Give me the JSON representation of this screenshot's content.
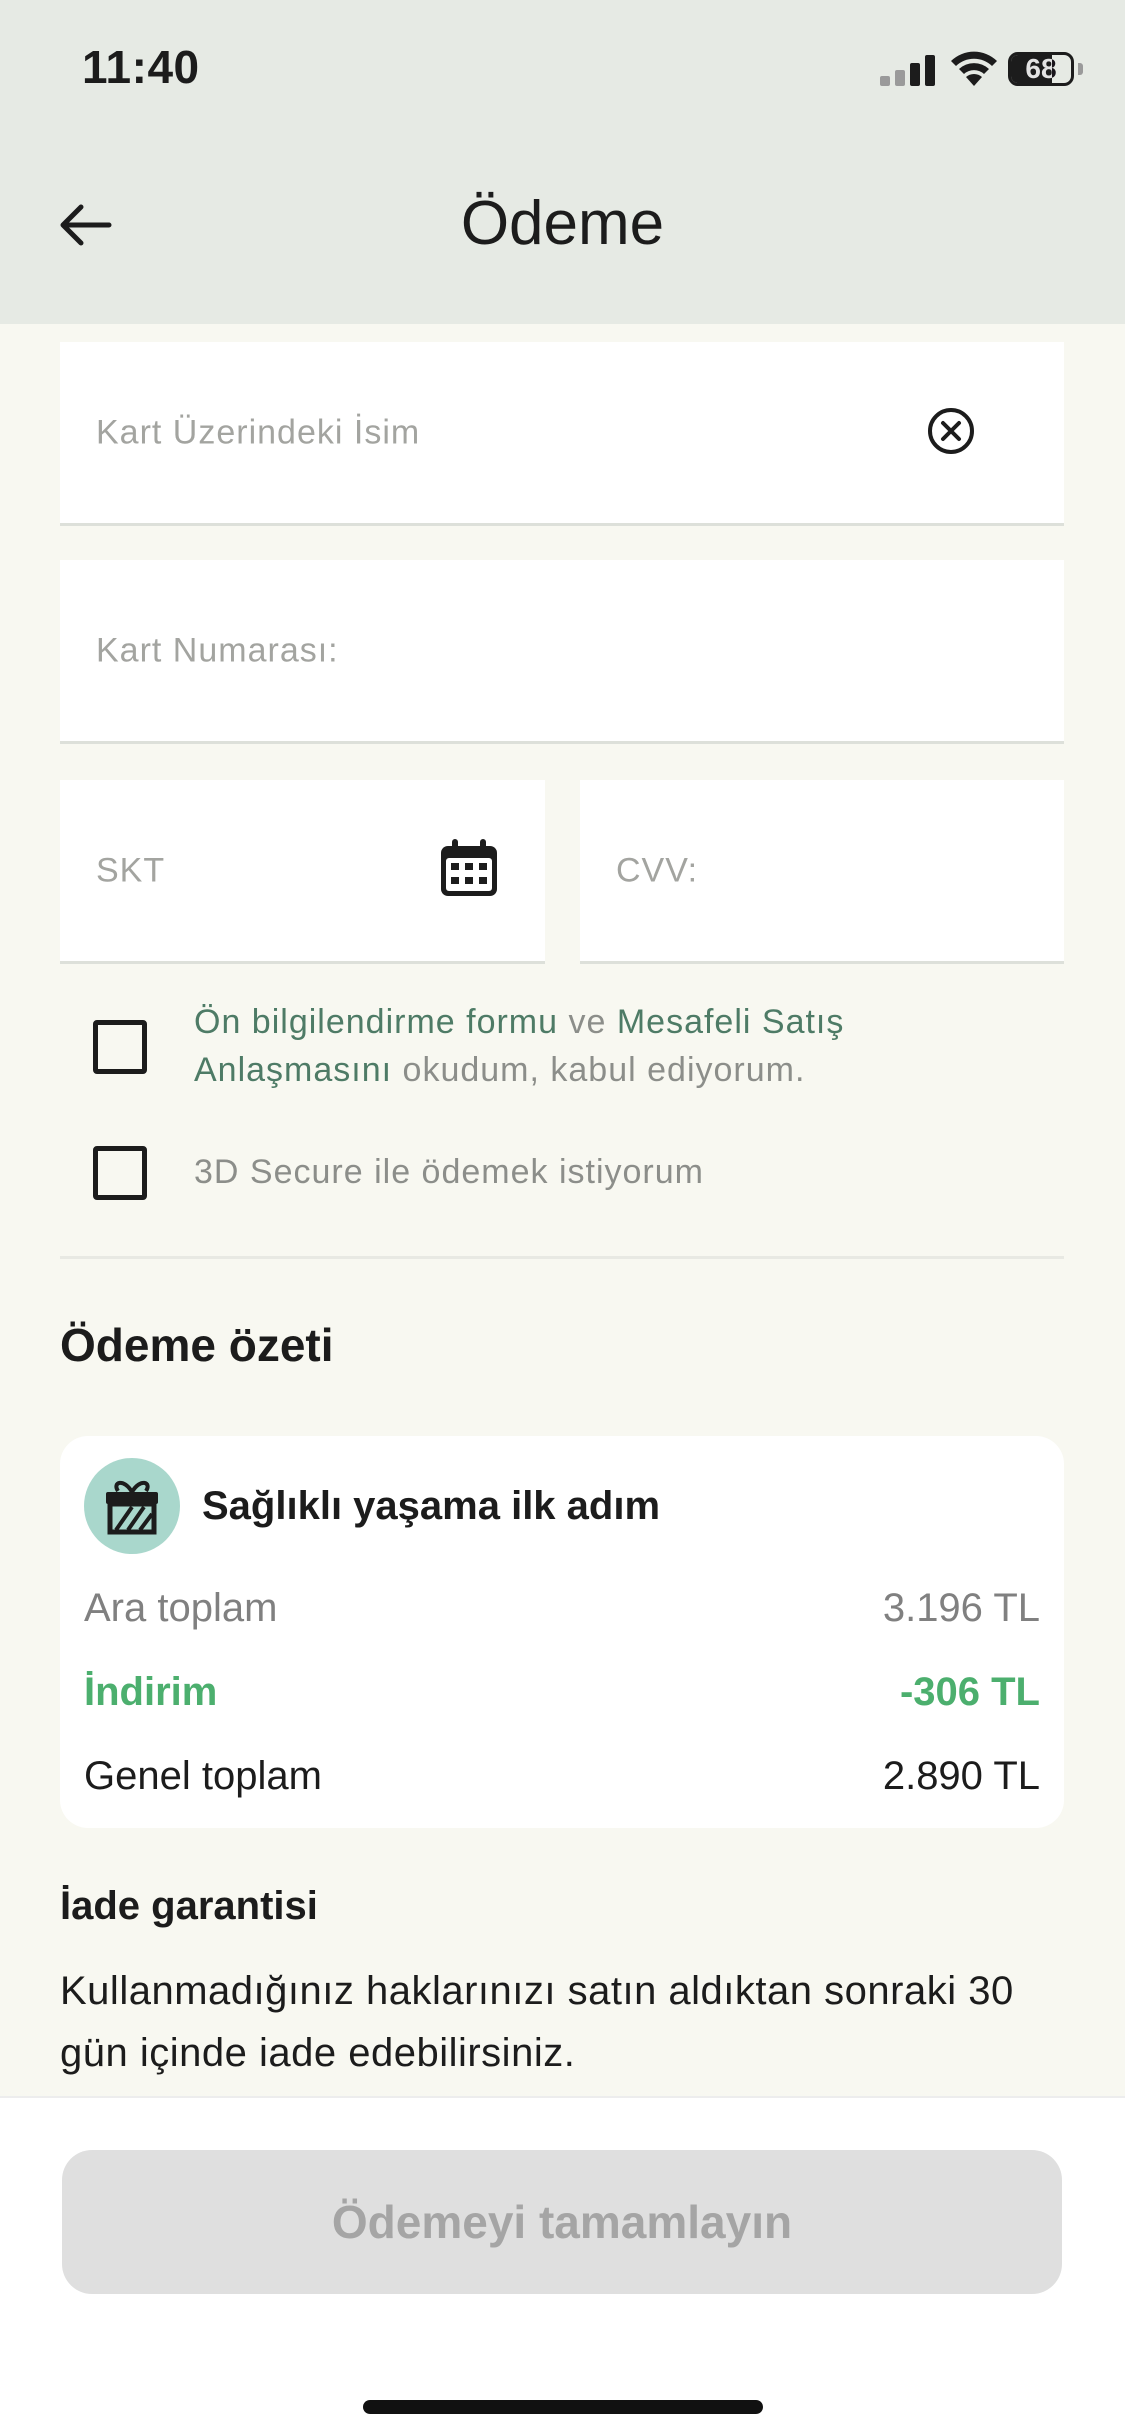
{
  "status_bar": {
    "time": "11:40",
    "battery": "68"
  },
  "header": {
    "title": "Ödeme",
    "back_icon": "arrow-left-icon"
  },
  "form": {
    "card_name_placeholder": "Kart Üzerindeki İsim",
    "card_number_placeholder": "Kart Numarası:",
    "expiry_placeholder": "SKT",
    "cvv_placeholder": "CVV:"
  },
  "agreements": {
    "preinfo_link": "Ön bilgilendirme formu",
    "conjunction": " ve ",
    "distance_sales_link": "Mesafeli Satış Anlaşmasını",
    "accept_suffix": " okudum, kabul ediyorum.",
    "secure_3d_label": "3D Secure ile ödemek istiyorum",
    "preinfo_checked": false,
    "secure_3d_checked": false
  },
  "summary": {
    "title": "Ödeme özeti",
    "package_name": "Sağlıklı yaşama ilk adım",
    "subtotal_label": "Ara toplam",
    "subtotal_value": "3.196 TL",
    "discount_label": "İndirim",
    "discount_value": "-306 TL",
    "total_label": "Genel toplam",
    "total_value": "2.890 TL"
  },
  "refund": {
    "title": "İade garantisi",
    "text": "Kullanmadığınız haklarınızı satın aldıktan sonraki 30 gün içinde iade edebilirsiniz."
  },
  "footer": {
    "pay_button_label": "Ödemeyi tamamlayın"
  },
  "colors": {
    "header_bg": "#E6EAE4",
    "page_bg": "#F8F8F1",
    "link_green": "#4E7B66",
    "discount_green": "#4CAF6E",
    "gift_circle": "#A9D7CC",
    "disabled_button": "#DFDFDF"
  }
}
